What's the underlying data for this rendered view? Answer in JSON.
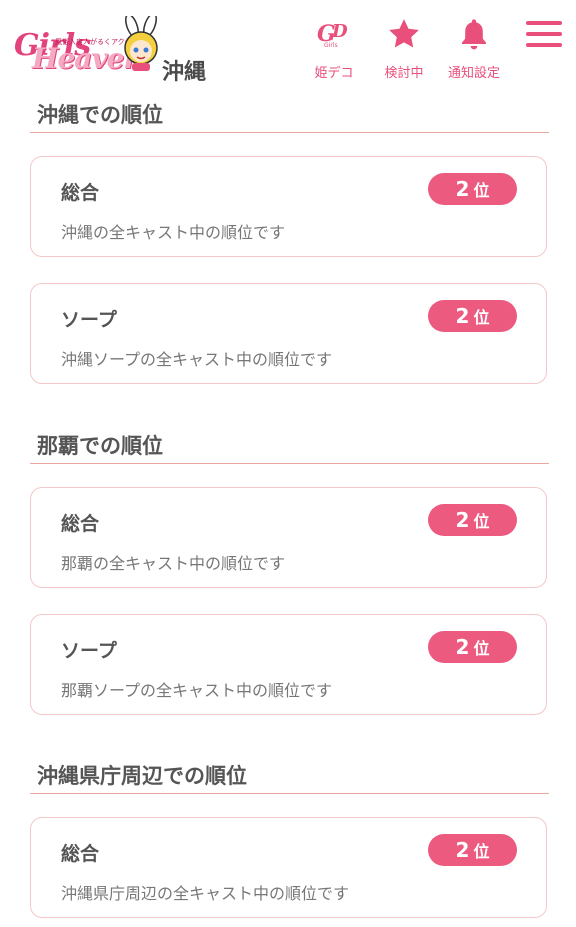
{
  "header": {
    "logo": {
      "brand_g": "Girls",
      "brand_name": "Heaven",
      "tagline": "風俗入店人がるくアクセス",
      "region": "沖縄"
    },
    "buttons": [
      {
        "label": "姫デコ",
        "icon": "gd-girls-icon"
      },
      {
        "label": "検討中",
        "icon": "star-icon"
      },
      {
        "label": "通知設定",
        "icon": "bell-icon"
      }
    ],
    "menu_icon": "hamburger-menu-icon",
    "accent_color": "#e94f7b"
  },
  "sections": [
    {
      "title": "沖縄での順位",
      "cards": [
        {
          "title": "総合",
          "desc": "沖縄の全キャスト中の順位です",
          "rank": "2",
          "rank_unit": "位"
        },
        {
          "title": "ソープ",
          "desc": "沖縄ソープの全キャスト中の順位です",
          "rank": "2",
          "rank_unit": "位"
        }
      ]
    },
    {
      "title": "那覇での順位",
      "cards": [
        {
          "title": "総合",
          "desc": "那覇の全キャスト中の順位です",
          "rank": "2",
          "rank_unit": "位"
        },
        {
          "title": "ソープ",
          "desc": "那覇ソープの全キャスト中の順位です",
          "rank": "2",
          "rank_unit": "位"
        }
      ]
    },
    {
      "title": "沖縄県庁周辺での順位",
      "cards": [
        {
          "title": "総合",
          "desc": "沖縄県庁周辺の全キャスト中の順位です",
          "rank": "2",
          "rank_unit": "位"
        }
      ]
    }
  ],
  "colors": {
    "badge": "#ec5a80",
    "card_border": "#f4c8c8",
    "rule": "#e9a8a3"
  }
}
